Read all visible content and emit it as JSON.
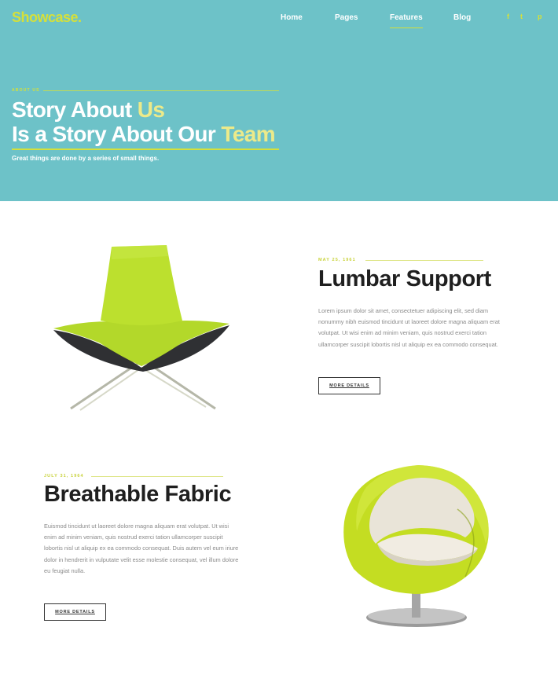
{
  "brand": {
    "logo": "Showcase."
  },
  "nav": {
    "items": [
      {
        "label": "Home",
        "active": false
      },
      {
        "label": "Pages",
        "active": false
      },
      {
        "label": "Features",
        "active": true
      },
      {
        "label": "Blog",
        "active": false
      }
    ]
  },
  "social": [
    {
      "icon": "facebook-icon",
      "glyph": "f"
    },
    {
      "icon": "twitter-icon",
      "glyph": "t"
    },
    {
      "icon": "pinterest-icon",
      "glyph": "p"
    }
  ],
  "hero": {
    "eyebrow": "ABOUT US",
    "line1_start": "Story About ",
    "line1_highlight": "Us",
    "line2_start": "Is a Story About Our ",
    "line2_highlight": "Team",
    "tagline": "Great things are done by a series of small things."
  },
  "sections": [
    {
      "date": "MAY 25, 1961",
      "title": "Lumbar Support",
      "body": "Lorem ipsum dolor sit amet, consectetuer adipiscing elit, sed diam nonummy nibh euismod tincidunt ut laoreet dolore magna aliquam erat volutpat. Ut wisi enim ad minim veniam, quis nostrud exerci tation ullamcorper suscipit lobortis nisl ut aliquip ex ea commodo consequat.",
      "button": "MORE DETAILS",
      "image": "green-lounge-chair"
    },
    {
      "date": "JULY 31, 1964",
      "title": "Breathable Fabric",
      "body": "Euismod tincidunt ut laoreet dolore magna aliquam erat volutpat. Ut wisi enim ad minim veniam, quis nostrud exerci tation ullamcorper suscipit lobortis nisl ut aliquip ex ea commodo consequat. Duis autem vel eum iriure dolor in hendrerit in vulputate velit esse molestie consequat, vel illum dolore eu feugiat nulla.",
      "button": "MORE DETAILS",
      "image": "green-egg-chair"
    }
  ],
  "colors": {
    "hero_bg": "#6dc2c8",
    "accent": "#d5e03a",
    "text_dark": "#1f1f1f",
    "text_muted": "#8a8a8a"
  }
}
